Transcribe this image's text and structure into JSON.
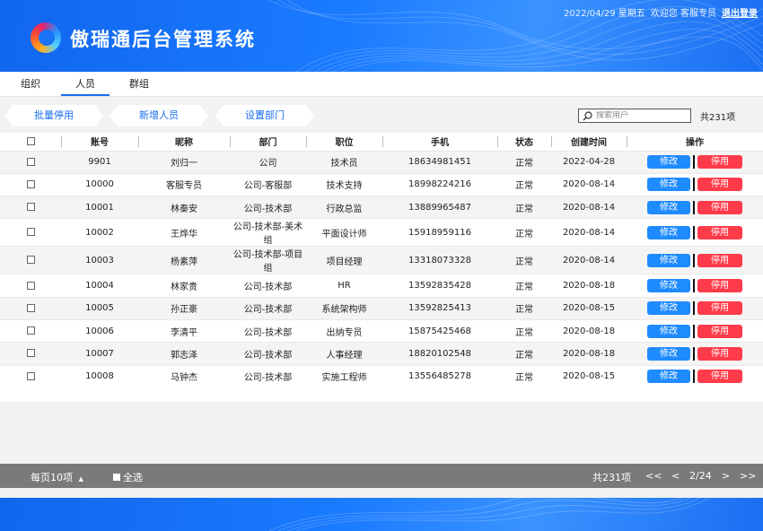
{
  "header": {
    "title": "傲瑞通后台管理系统",
    "date": "2022/04/29 星期五",
    "welcome": "欢迎您 客服专员",
    "logout": "退出登录"
  },
  "tabs": [
    {
      "label": "组织",
      "active": false
    },
    {
      "label": "人员",
      "active": true
    },
    {
      "label": "群组",
      "active": false
    }
  ],
  "toolbar": {
    "batch_disable": "批量停用",
    "add_person": "新增人员",
    "set_department": "设置部门",
    "search_placeholder": "搜索用户",
    "total": "共231项"
  },
  "table": {
    "columns": [
      "账号",
      "昵称",
      "部门",
      "职位",
      "手机",
      "状态",
      "创建时间",
      "操作"
    ],
    "edit_label": "修改",
    "disable_label": "停用",
    "rows": [
      {
        "account": "9901",
        "nickname": "刘归一",
        "dept": "公司",
        "position": "技术员",
        "phone": "18634981451",
        "status": "正常",
        "created": "2022-04-28"
      },
      {
        "account": "10000",
        "nickname": "客服专员",
        "dept": "公司-客服部",
        "position": "技术支持",
        "phone": "18998224216",
        "status": "正常",
        "created": "2020-08-14"
      },
      {
        "account": "10001",
        "nickname": "林秦安",
        "dept": "公司-技术部",
        "position": "行政总监",
        "phone": "13889965487",
        "status": "正常",
        "created": "2020-08-14"
      },
      {
        "account": "10002",
        "nickname": "王烨华",
        "dept": "公司-技术部-美术组",
        "position": "平面设计师",
        "phone": "15918959116",
        "status": "正常",
        "created": "2020-08-14"
      },
      {
        "account": "10003",
        "nickname": "杨素萍",
        "dept": "公司-技术部-项目组",
        "position": "项目经理",
        "phone": "13318073328",
        "status": "正常",
        "created": "2020-08-14"
      },
      {
        "account": "10004",
        "nickname": "林家贵",
        "dept": "公司-技术部",
        "position": "HR",
        "phone": "13592835428",
        "status": "正常",
        "created": "2020-08-18"
      },
      {
        "account": "10005",
        "nickname": "孙正豪",
        "dept": "公司-技术部",
        "position": "系统架构师",
        "phone": "13592825413",
        "status": "正常",
        "created": "2020-08-15"
      },
      {
        "account": "10006",
        "nickname": "李清平",
        "dept": "公司-技术部",
        "position": "出纳专员",
        "phone": "15875425468",
        "status": "正常",
        "created": "2020-08-18"
      },
      {
        "account": "10007",
        "nickname": "郭志泽",
        "dept": "公司-技术部",
        "position": "人事经理",
        "phone": "18820102548",
        "status": "正常",
        "created": "2020-08-18"
      },
      {
        "account": "10008",
        "nickname": "马钟杰",
        "dept": "公司-技术部",
        "position": "实施工程师",
        "phone": "13556485278",
        "status": "正常",
        "created": "2020-08-15"
      }
    ]
  },
  "pager": {
    "per_page": "每页10项",
    "select_all": "全选",
    "total": "共231项",
    "first": "<<",
    "prev": "<",
    "page": "2/24",
    "next": ">",
    "last": ">>"
  },
  "colors": {
    "brand_blue": "#1a6ef0",
    "edit_blue": "#1e8bff",
    "disable_red": "#ff3b4a",
    "pager_gray": "#7a7a7a"
  }
}
